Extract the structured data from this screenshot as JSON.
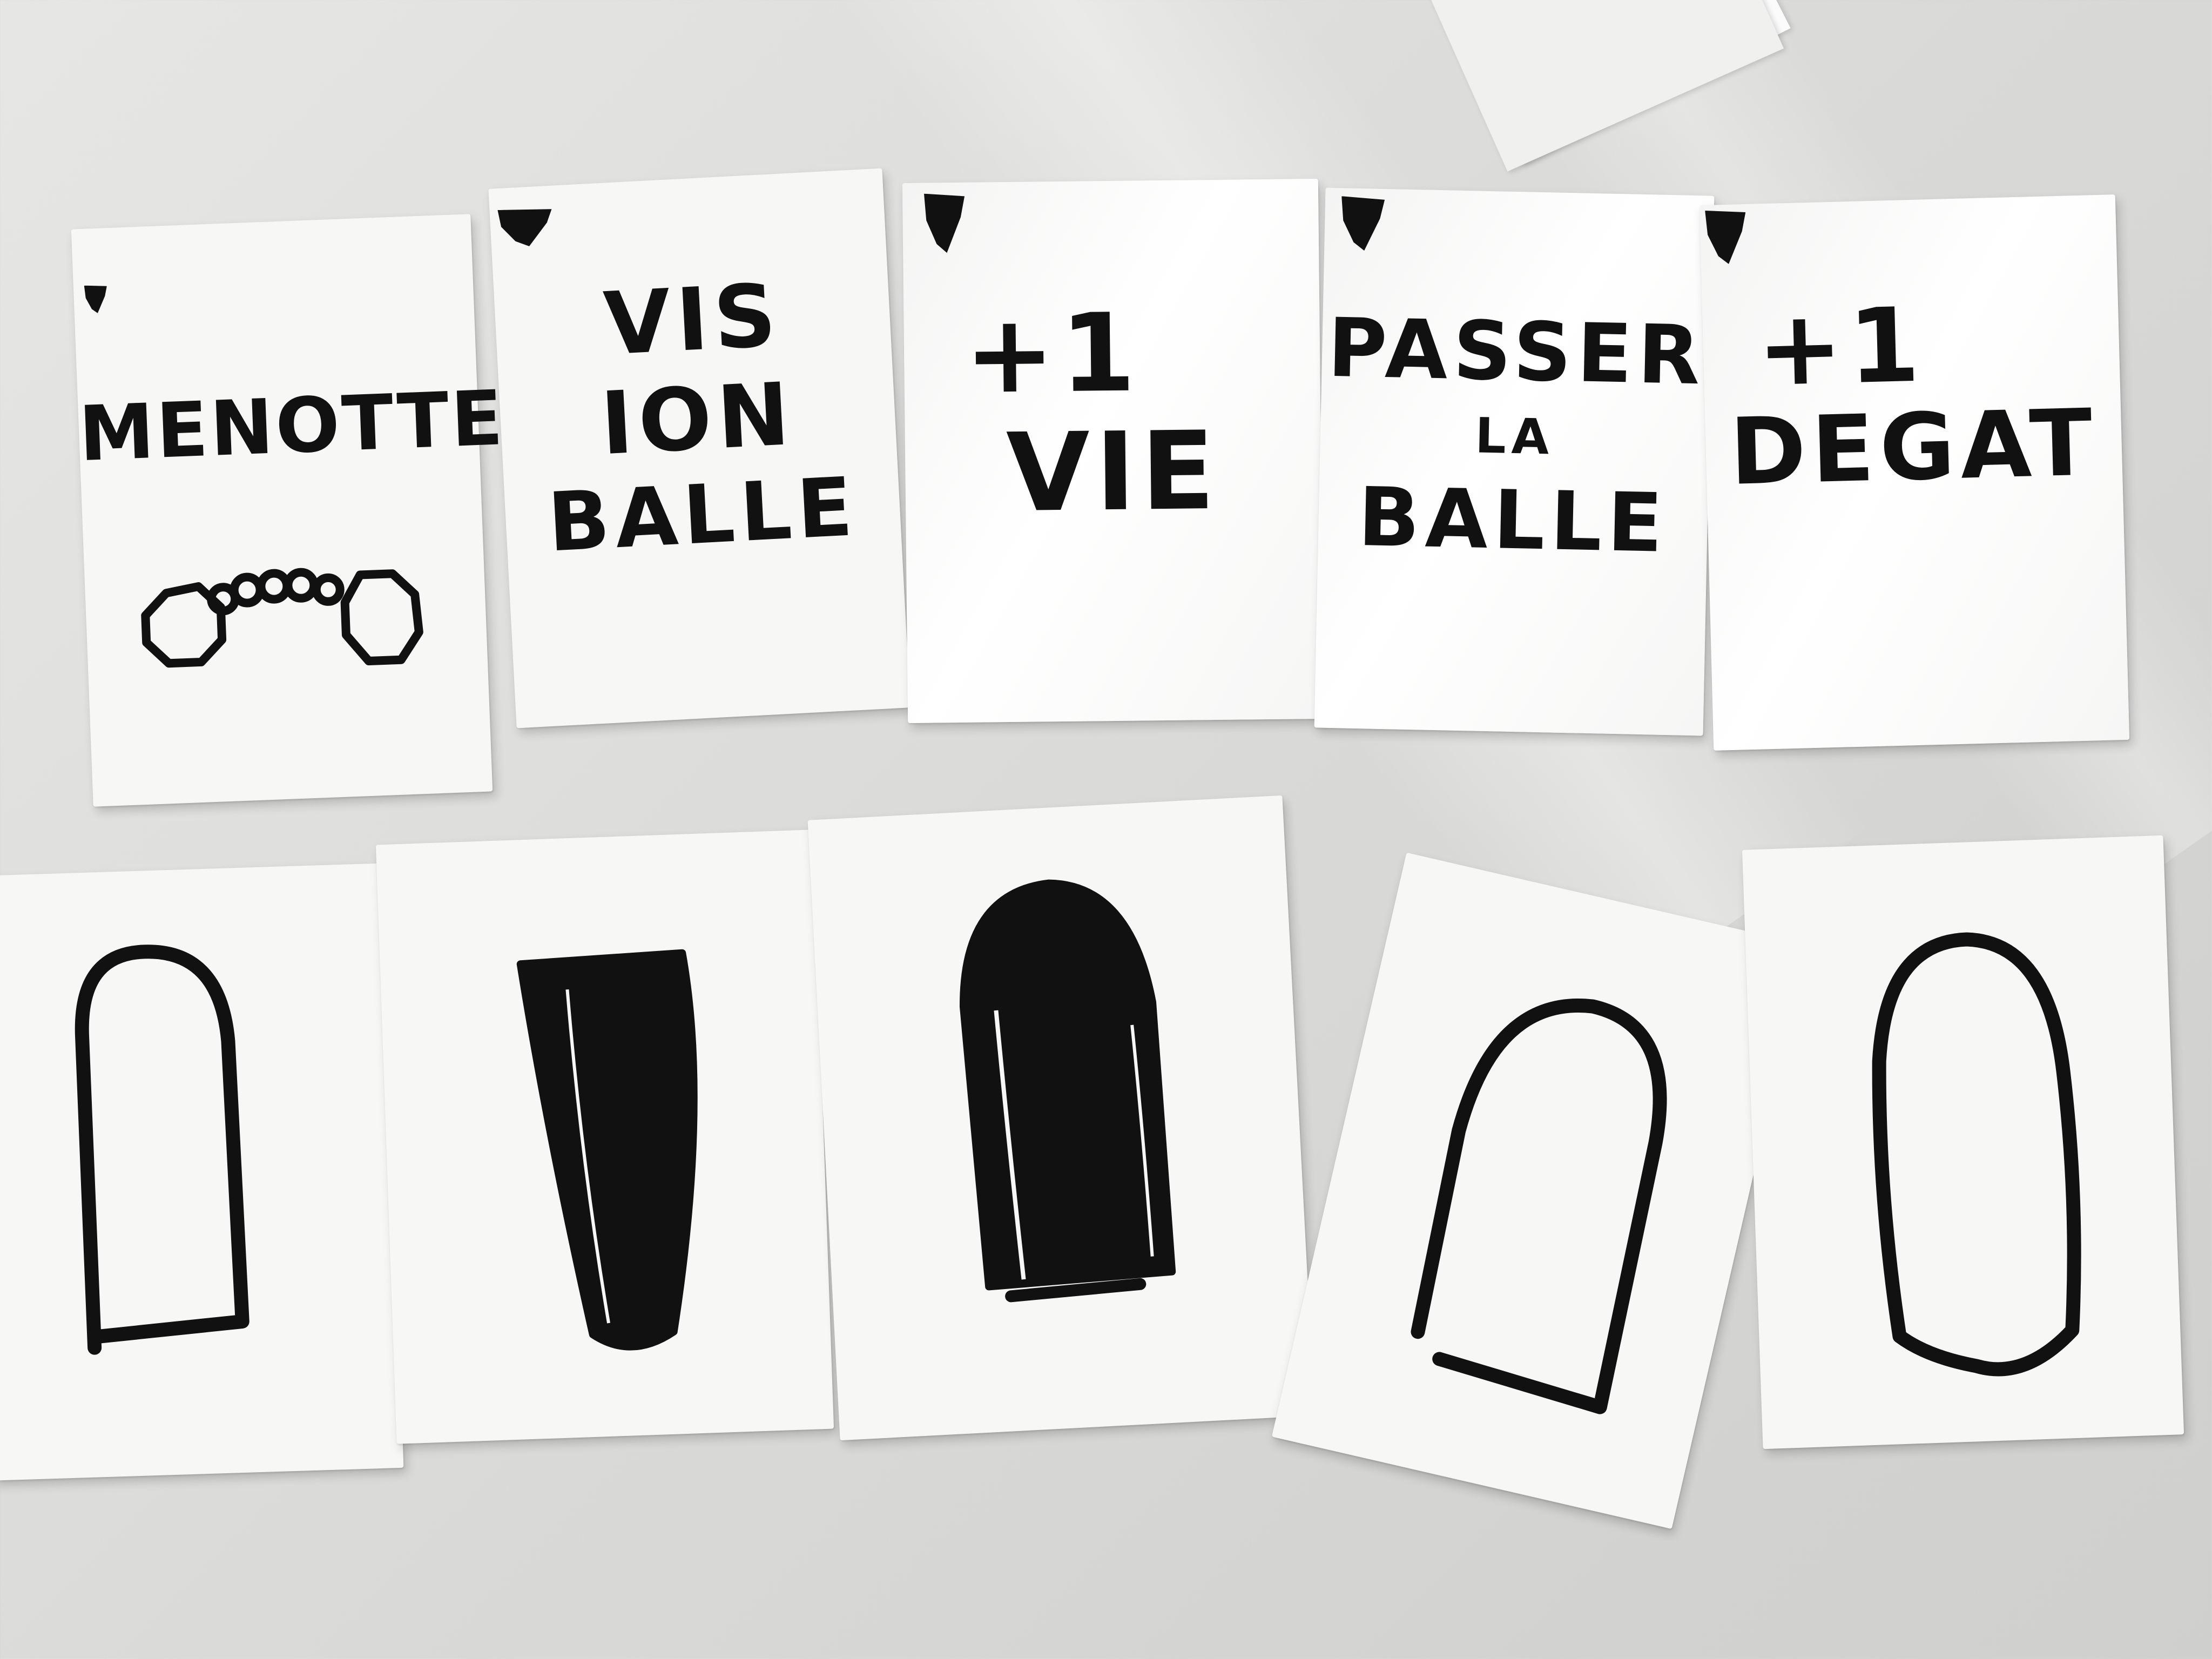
{
  "scene": {
    "surface_color": "#d9d9d7",
    "card_color": "#f7f7f6",
    "ink_color": "#111111"
  },
  "top_row": [
    {
      "id": "menotte",
      "lines": [
        "MENOTTE"
      ],
      "icon": "handcuffs-icon"
    },
    {
      "id": "vision-balle",
      "lines": [
        "VIS",
        "ION",
        "BALLE"
      ],
      "icon": null
    },
    {
      "id": "plus-vie",
      "lines": [
        "+1",
        "VIE"
      ],
      "icon": null
    },
    {
      "id": "passer-balle",
      "lines": [
        "PASSER",
        "LA",
        "BALLE"
      ],
      "icon": null
    },
    {
      "id": "plus-degat",
      "lines": [
        "+1",
        "DEGAT"
      ],
      "icon": null
    }
  ],
  "bottom_row": [
    {
      "id": "bullet-1",
      "icon": "empty-bullet-icon",
      "filled": false
    },
    {
      "id": "bullet-2",
      "icon": "filled-bullet-icon",
      "filled": true
    },
    {
      "id": "bullet-3",
      "icon": "filled-bullet-icon",
      "filled": true
    },
    {
      "id": "bullet-4",
      "icon": "empty-bullet-icon",
      "filled": false
    },
    {
      "id": "bullet-5",
      "icon": "empty-bullet-icon",
      "filled": false
    }
  ]
}
